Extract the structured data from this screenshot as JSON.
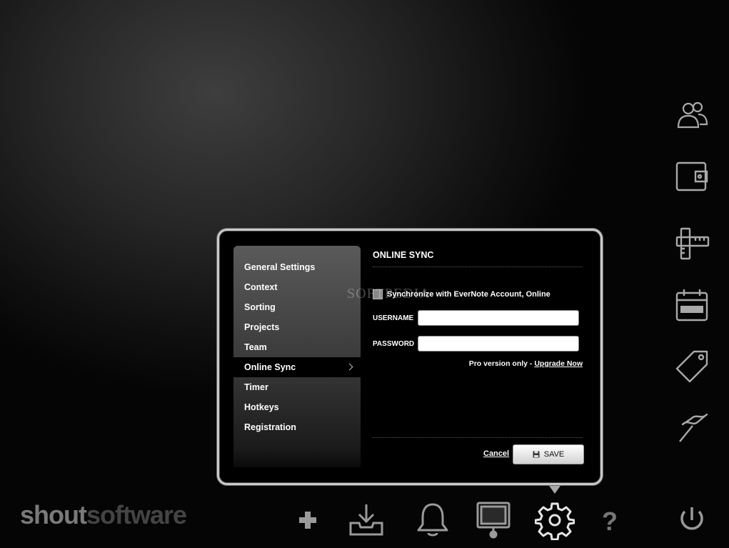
{
  "dialog": {
    "menu_items": [
      {
        "label": "General Settings"
      },
      {
        "label": "Context"
      },
      {
        "label": "Sorting"
      },
      {
        "label": "Projects"
      },
      {
        "label": "Team"
      },
      {
        "label": "Online Sync",
        "active": true
      },
      {
        "label": "Timer"
      },
      {
        "label": "Hotkeys"
      },
      {
        "label": "Registration"
      }
    ],
    "panel": {
      "title": "ONLINE SYNC",
      "sync_checkbox_label": "Synchronize with EverNote Account, Online",
      "sync_checked": false,
      "username_label": "USERNAME",
      "username_value": "",
      "password_label": "PASSWORD",
      "password_value": "",
      "pro_note": "Pro version only - ",
      "upgrade_link": "Upgrade Now",
      "cancel_label": "Cancel",
      "save_label": "SAVE"
    }
  },
  "logo": {
    "part1": "shout",
    "part2": "software"
  },
  "watermark": "SOFTPEDIA",
  "right_rail": [
    "users-icon",
    "wallet-icon",
    "ruler-icon",
    "calendar-icon",
    "tag-icon",
    "flag-icon"
  ],
  "bottom_bar": [
    "add-icon",
    "download-tray-icon",
    "bell-icon",
    "monitor-icon",
    "gear-icon",
    "help-icon",
    "power-icon"
  ],
  "colors": {
    "background": "#0a0a0a",
    "dialog_border": "#c9c9c9",
    "menu_active": "#000000",
    "icon": "#a9a9a9"
  }
}
